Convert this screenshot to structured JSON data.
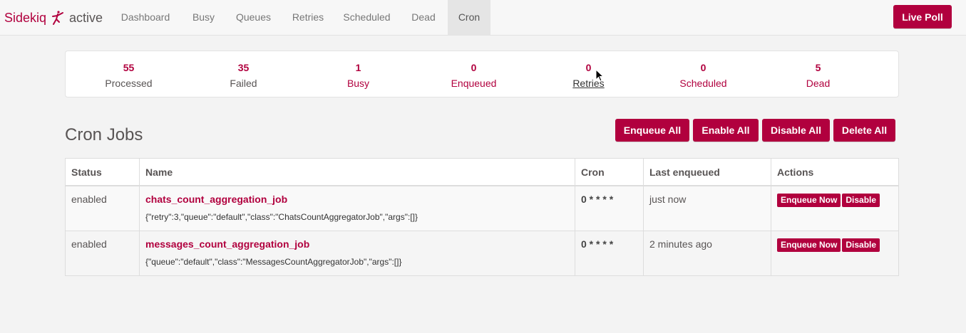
{
  "navbar": {
    "brand": "Sidekiq",
    "status": "active",
    "tabs": [
      {
        "label": "Dashboard",
        "active": false
      },
      {
        "label": "Busy",
        "active": false
      },
      {
        "label": "Queues",
        "active": false
      },
      {
        "label": "Retries",
        "active": false
      },
      {
        "label": "Scheduled",
        "active": false
      },
      {
        "label": "Dead",
        "active": false
      },
      {
        "label": "Cron",
        "active": true
      }
    ],
    "live_poll": "Live Poll"
  },
  "summary": [
    {
      "count": "55",
      "label": "Processed"
    },
    {
      "count": "35",
      "label": "Failed"
    },
    {
      "count": "1",
      "label": "Busy"
    },
    {
      "count": "0",
      "label": "Enqueued"
    },
    {
      "count": "0",
      "label": "Retries"
    },
    {
      "count": "0",
      "label": "Scheduled"
    },
    {
      "count": "5",
      "label": "Dead"
    }
  ],
  "page": {
    "title": "Cron Jobs",
    "actions": {
      "enqueue_all": "Enqueue All",
      "enable_all": "Enable All",
      "disable_all": "Disable All",
      "delete_all": "Delete All"
    }
  },
  "table": {
    "headers": {
      "status": "Status",
      "name": "Name",
      "cron": "Cron",
      "last_enqueued": "Last enqueued",
      "actions": "Actions"
    },
    "rows": [
      {
        "status": "enabled",
        "name": "chats_count_aggregation_job",
        "args": "{\"retry\":3,\"queue\":\"default\",\"class\":\"ChatsCountAggregatorJob\",\"args\":[]}",
        "cron": "0 * * * *",
        "last_enqueued": "just now",
        "enqueue_now": "Enqueue Now",
        "disable": "Disable"
      },
      {
        "status": "enabled",
        "name": "messages_count_aggregation_job",
        "args": "{\"queue\":\"default\",\"class\":\"MessagesCountAggregatorJob\",\"args\":[]}",
        "cron": "0 * * * *",
        "last_enqueued": "2 minutes ago",
        "enqueue_now": "Enqueue Now",
        "disable": "Disable"
      }
    ]
  },
  "colors": {
    "accent": "#b1003e",
    "text": "#585454",
    "background": "#f3f3f3"
  }
}
